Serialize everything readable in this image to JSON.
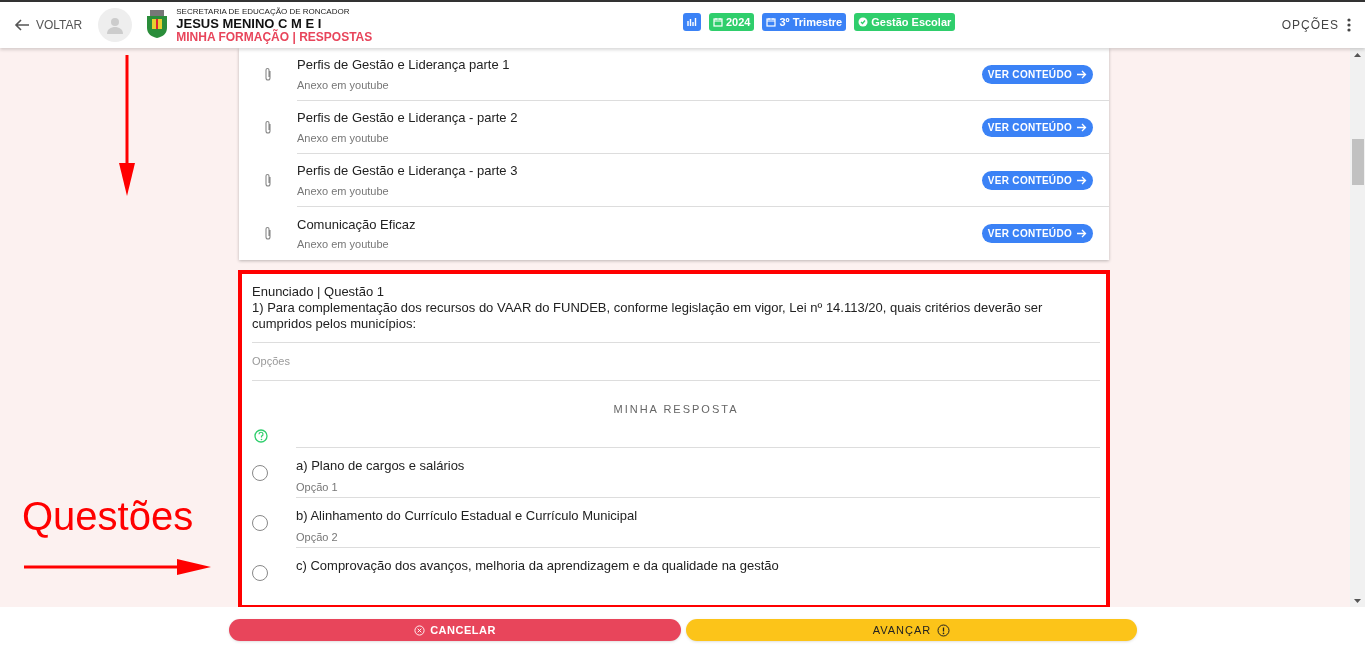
{
  "header": {
    "back_label": "VOLTAR",
    "secretariat": "SECRETARIA DE EDUCAÇÃO DE RONCADOR",
    "school": "JESUS MENINO C M E I",
    "section": "MINHA FORMAÇÃO | RESPOSTAS",
    "badges": [
      {
        "kind": "chart",
        "color": "#3b82f6"
      },
      {
        "kind": "calendar",
        "text": "2024",
        "color": "#2fce6c"
      },
      {
        "kind": "calendar",
        "text": "3º Trimestre",
        "color": "#3b82f6"
      },
      {
        "kind": "check",
        "text": "Gestão Escolar",
        "color": "#2fce6c"
      }
    ],
    "options_label": "OPÇÕES"
  },
  "attachments": [
    {
      "title": "Perfis de Gestão e Liderança parte 1",
      "subtitle": "Anexo em youtube",
      "button": "VER CONTEÚDO"
    },
    {
      "title": "Perfis de Gestão e Liderança - parte 2",
      "subtitle": "Anexo em youtube",
      "button": "VER CONTEÚDO"
    },
    {
      "title": "Perfis de Gestão e Liderança - parte 3",
      "subtitle": "Anexo em youtube",
      "button": "VER CONTEÚDO"
    },
    {
      "title": "Comunicação Eficaz",
      "subtitle": "Anexo em youtube",
      "button": "VER CONTEÚDO"
    }
  ],
  "question": {
    "heading": "Enunciado | Questão 1",
    "text": "1) Para complementação dos recursos do VAAR do FUNDEB, conforme legislação em vigor, Lei nº 14.113/20, quais critérios deverão ser cumpridos pelos municípios:",
    "options_label": "Opções",
    "answer_label": "MINHA RESPOSTA",
    "options": [
      {
        "text": "a) Plano de cargos e salários",
        "sub": "Opção 1",
        "selected": false
      },
      {
        "text": "b) Alinhamento do Currículo Estadual e Currículo Municipal",
        "sub": "Opção 2",
        "selected": false
      },
      {
        "text": "c) Comprovação dos avanços, melhoria da aprendizagem e da qualidade na gestão",
        "selected": false
      }
    ]
  },
  "annotation": {
    "label": "Questões"
  },
  "footer": {
    "cancel": "CANCELAR",
    "next": "AVANÇAR"
  }
}
